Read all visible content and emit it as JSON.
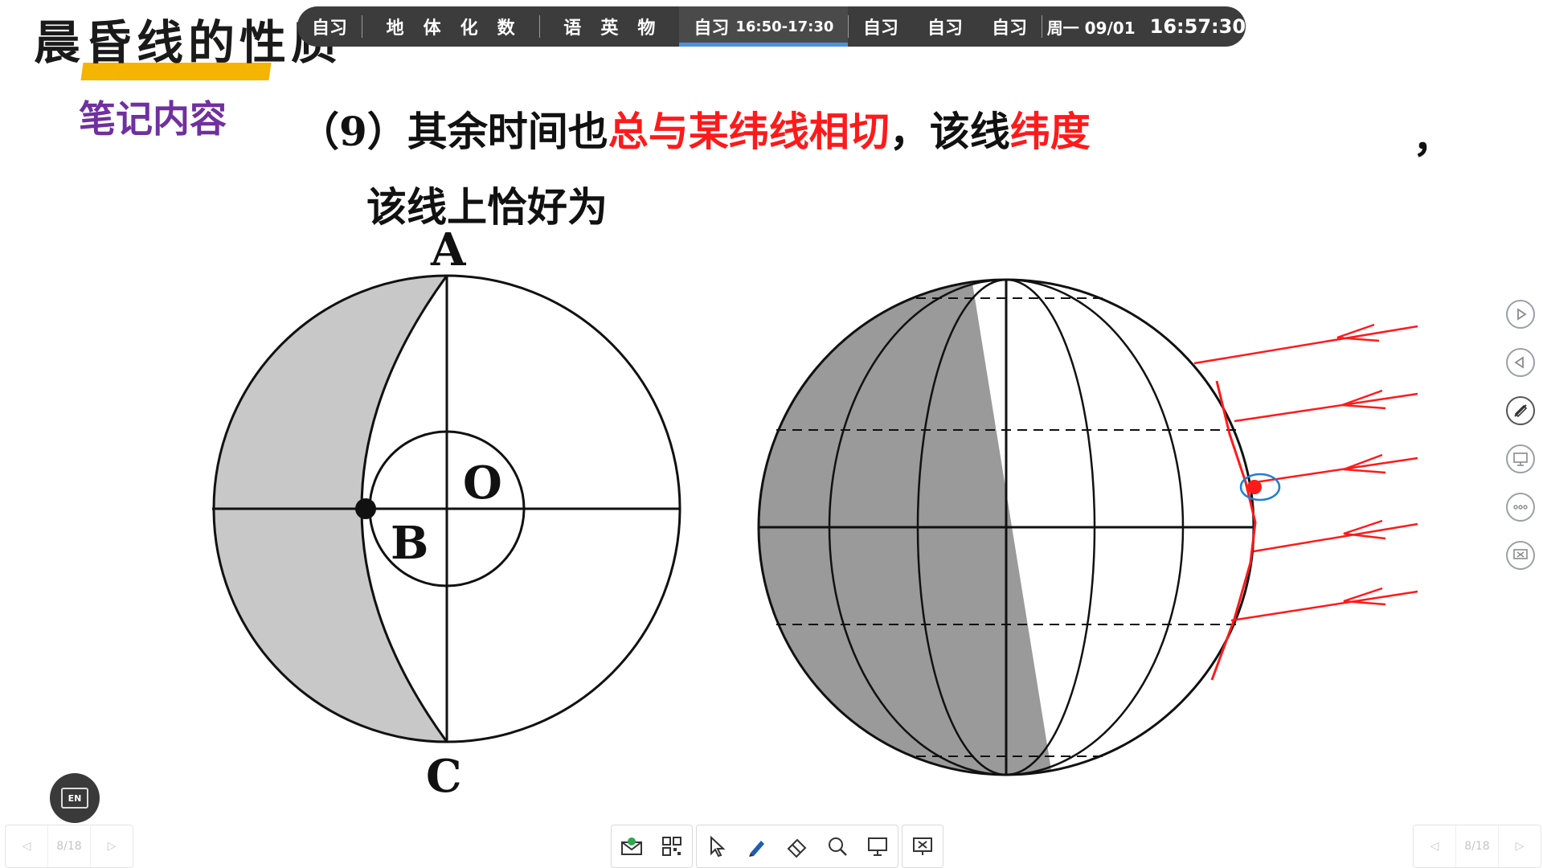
{
  "slide": {
    "title": "晨昏线的性质",
    "subtitle": "笔记内容",
    "question": {
      "prefix": "（9）其余时间也",
      "highlight1": "总与某纬线相切",
      "middle": "，该线",
      "highlight2": "纬度",
      "comma": "，",
      "line2": "该线上恰好为"
    },
    "left_diagram_labels": {
      "a": "A",
      "b": "B",
      "c": "C",
      "o": "O"
    }
  },
  "schedule_bar": {
    "items": [
      {
        "label": "自习"
      },
      {
        "subjects": [
          "地",
          "体",
          "化",
          "数"
        ]
      },
      {
        "subjects": [
          "语",
          "英",
          "物"
        ]
      },
      {
        "label": "自习",
        "time": "16:50-17:30",
        "current": true
      },
      {
        "label": "自习"
      },
      {
        "label": "自习"
      },
      {
        "label": "自习"
      }
    ],
    "date": "周一 09/01",
    "clock": "16:57:30"
  },
  "side_buttons": [
    "play-next-icon",
    "play-prev-icon",
    "pen-off-icon",
    "screen-share-icon",
    "more-icon",
    "exit-screen-icon"
  ],
  "toolbar": {
    "buttons": [
      "mail-icon",
      "qr-grid-icon",
      "cursor-icon",
      "pen-icon",
      "eraser-icon",
      "search-icon",
      "whiteboard-icon",
      "close-screen-icon"
    ]
  },
  "pager_left": {
    "page": "8/18"
  },
  "pager_right": {
    "page": "8/18"
  },
  "lang_button": {
    "label": "EN"
  },
  "colors": {
    "accent_red": "#ff1a1a",
    "subtitle_purple": "#7030a0",
    "underline_yellow": "#f4b400",
    "ink_blue": "#1e7fd0"
  }
}
